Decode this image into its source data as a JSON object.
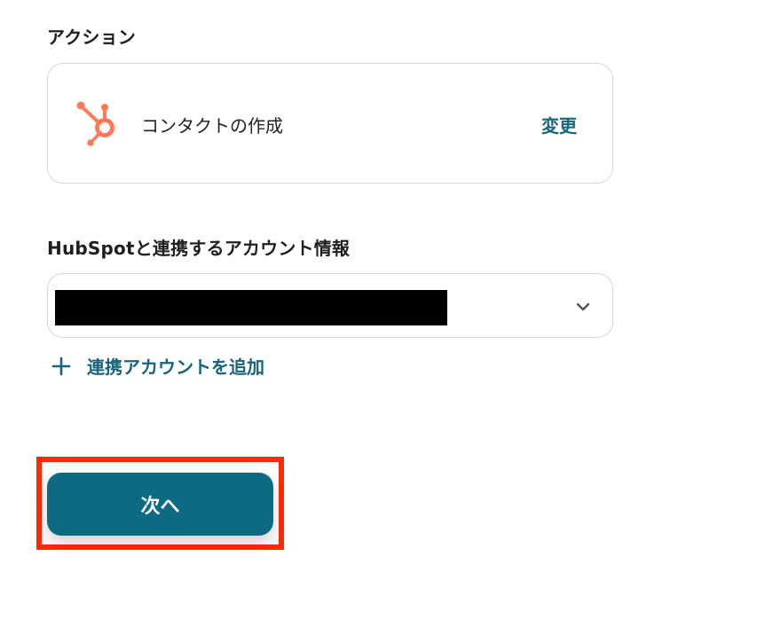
{
  "action_section": {
    "label": "アクション",
    "action_name": "コンタクトの作成",
    "change_label": "変更",
    "icon": "hubspot-icon",
    "brand_color": "#ff7a59"
  },
  "account_section": {
    "label": "HubSpotと連携するアカウント情報",
    "selected_value": "",
    "dropdown_icon": "chevron-down-icon",
    "add_account_label": "連携アカウントを追加",
    "add_icon": "plus-icon"
  },
  "next_button": {
    "label": "次へ"
  },
  "colors": {
    "accent": "#17647c",
    "primary_button": "#0c6a82",
    "highlight": "#ff2a00"
  }
}
